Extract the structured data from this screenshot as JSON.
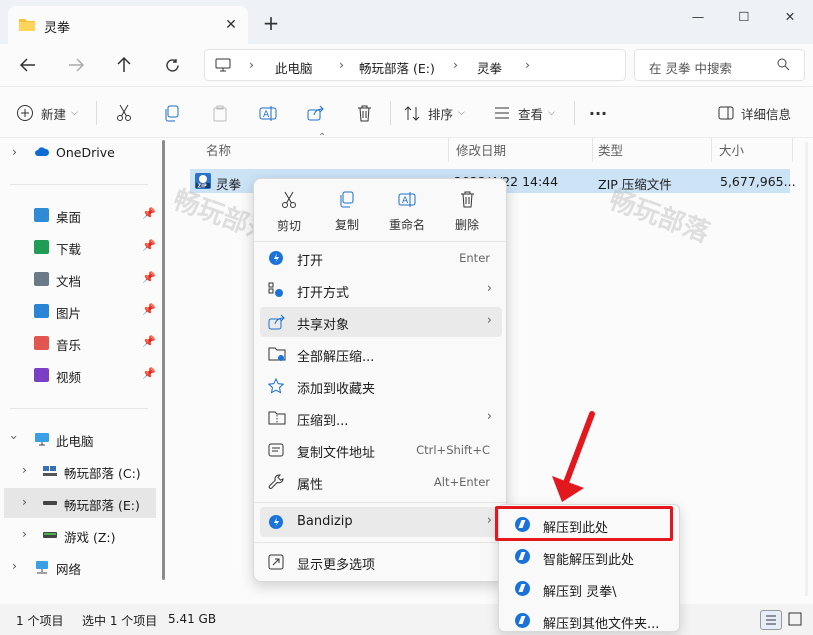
{
  "window": {
    "tab_title": "灵拳",
    "new_tab": "+",
    "close_tab": "✕",
    "controls": {
      "minimize": "—",
      "maximize": "☐",
      "close": "✕"
    }
  },
  "address": {
    "crumbs": [
      "此电脑",
      "畅玩部落 (E:)",
      "灵拳"
    ],
    "search_placeholder": "在 灵拳 中搜索"
  },
  "toolbar": {
    "new_label": "新建",
    "sort_label": "排序",
    "view_label": "查看",
    "more_label": "···",
    "details_label": "详细信息"
  },
  "nav": {
    "onedrive": "OneDrive",
    "quick": [
      {
        "label": "桌面",
        "icon": "desktop-icon"
      },
      {
        "label": "下载",
        "icon": "download-icon"
      },
      {
        "label": "文档",
        "icon": "document-icon"
      },
      {
        "label": "图片",
        "icon": "picture-icon"
      },
      {
        "label": "音乐",
        "icon": "music-icon"
      },
      {
        "label": "视频",
        "icon": "video-icon"
      }
    ],
    "this_pc": "此电脑",
    "drives": [
      "畅玩部落 (C:)",
      "畅玩部落 (E:)",
      "游戏 (Z:)"
    ],
    "network": "网络"
  },
  "columns": {
    "name": "名称",
    "modified": "修改日期",
    "type": "类型",
    "size": "大小"
  },
  "file": {
    "name": "灵拳",
    "modified": "2023/4/22 14:44",
    "type": "ZIP 压缩文件",
    "size": "5,677,965..."
  },
  "watermark": "畅玩部落",
  "context_menu": {
    "quick_actions": [
      "剪切",
      "复制",
      "重命名",
      "删除"
    ],
    "items": [
      {
        "label": "打开",
        "shortcut": "Enter"
      },
      {
        "label": "打开方式",
        "shortcut": "›"
      },
      {
        "label": "共享对象",
        "shortcut": "›"
      },
      {
        "label": "全部解压缩...",
        "shortcut": ""
      },
      {
        "label": "添加到收藏夹",
        "shortcut": ""
      },
      {
        "label": "压缩到...",
        "shortcut": "›"
      },
      {
        "label": "复制文件地址",
        "shortcut": "Ctrl+Shift+C"
      },
      {
        "label": "属性",
        "shortcut": "Alt+Enter"
      },
      {
        "label": "Bandizip",
        "shortcut": "›"
      },
      {
        "label": "显示更多选项",
        "shortcut": ""
      }
    ]
  },
  "bandizip_submenu": [
    "解压到此处",
    "智能解压到此处",
    "解压到 灵拳\\",
    "解压到其他文件夹..."
  ],
  "status": {
    "count": "1 个项目",
    "selected": "选中 1 个项目",
    "size": "5.41 GB"
  },
  "colors": {
    "accent": "#1a73d9",
    "highlight_box": "#e3171e",
    "selection": "#cce3f6"
  }
}
